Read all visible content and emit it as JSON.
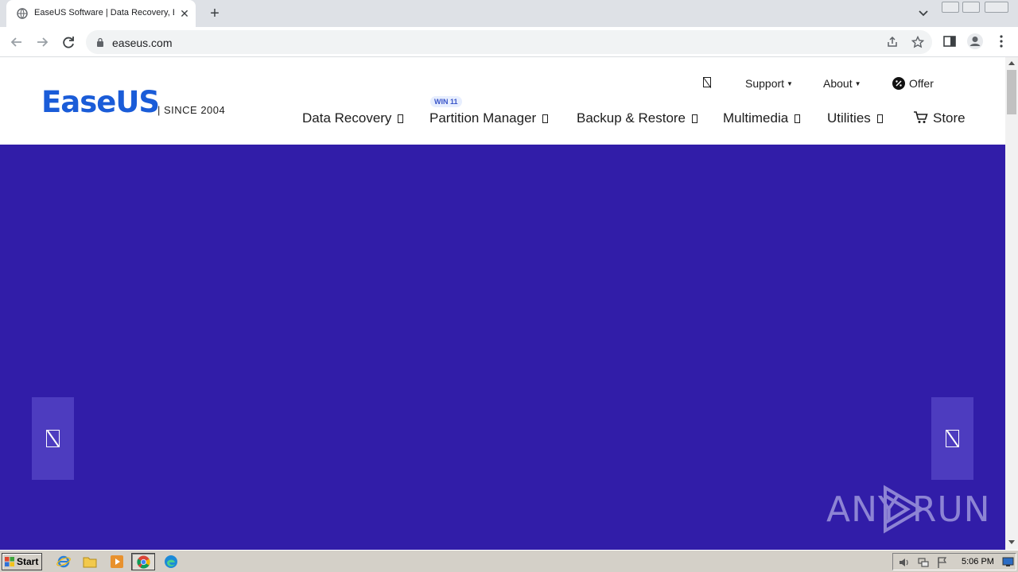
{
  "browser": {
    "tab_title": "EaseUS Software | Data Recovery, B",
    "url": "easeus.com"
  },
  "site": {
    "logo_text": "EaseUS",
    "logo_since": "| SINCE 2004",
    "top_nav": {
      "support": "Support",
      "about": "About",
      "offer": "Offer"
    },
    "badge": "WIN 11",
    "main_nav": [
      {
        "label": "Data Recovery"
      },
      {
        "label": "Partition Manager"
      },
      {
        "label": "Backup & Restore"
      },
      {
        "label": "Multimedia"
      },
      {
        "label": "Utilities"
      },
      {
        "label": "Store"
      }
    ],
    "colors": {
      "hero_bg": "#311da8",
      "brand_blue": "#1a5cd8"
    }
  },
  "watermark": "ANY RUN",
  "taskbar": {
    "start_label": "Start",
    "clock": "5:06 PM"
  }
}
